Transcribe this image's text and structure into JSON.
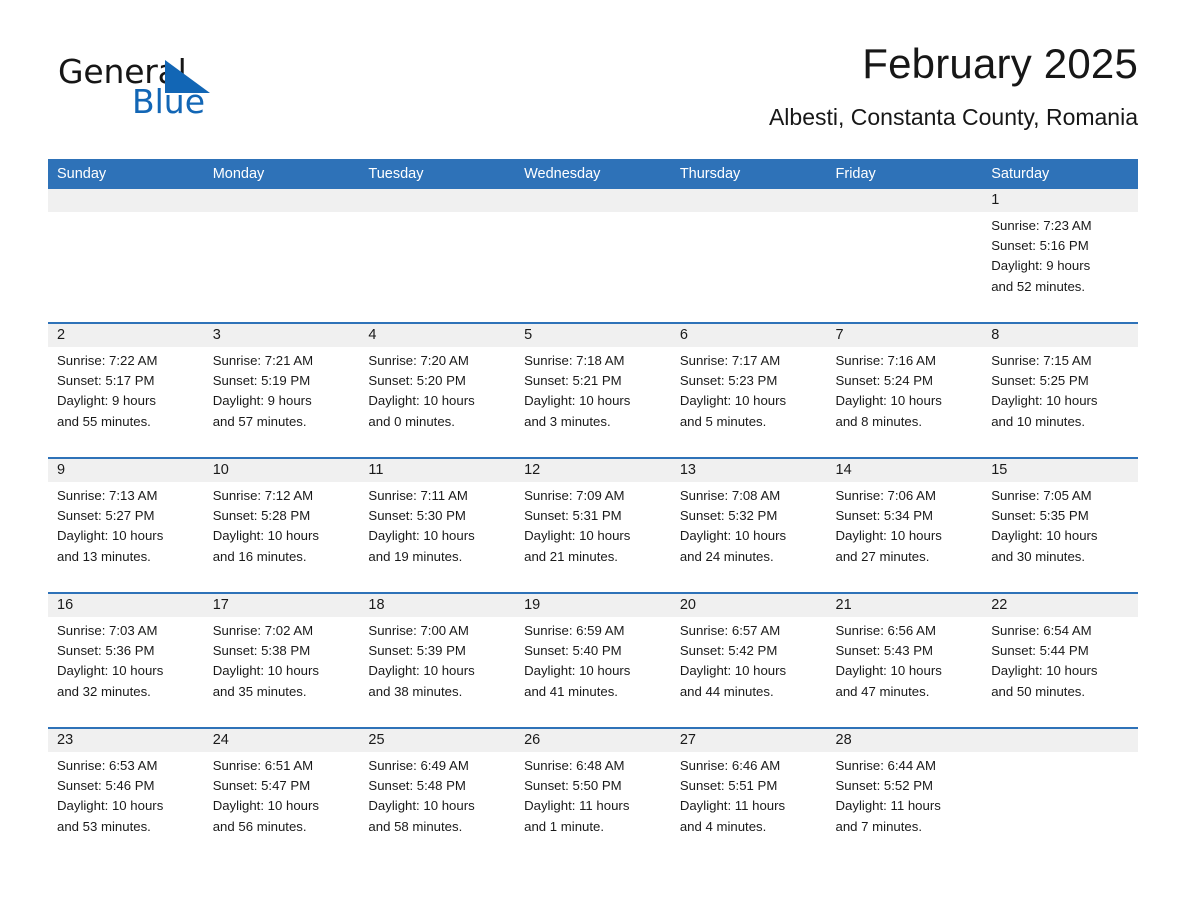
{
  "brand": {
    "name_part1": "General",
    "name_part2": "Blue",
    "logo_icon": "triangle-flag-icon",
    "accent_color": "#1266b5"
  },
  "header": {
    "title": "February 2025",
    "location": "Albesti, Constanta County, Romania"
  },
  "theme": {
    "header_blue": "#2e72b8",
    "day_band_gray": "#f0f0f0",
    "text_color": "#1a1a1a"
  },
  "calendar": {
    "weekday_headers": [
      "Sunday",
      "Monday",
      "Tuesday",
      "Wednesday",
      "Thursday",
      "Friday",
      "Saturday"
    ],
    "weeks": [
      [
        {
          "day": "",
          "info": "",
          "empty": true
        },
        {
          "day": "",
          "info": "",
          "empty": true
        },
        {
          "day": "",
          "info": "",
          "empty": true
        },
        {
          "day": "",
          "info": "",
          "empty": true
        },
        {
          "day": "",
          "info": "",
          "empty": true
        },
        {
          "day": "",
          "info": "",
          "empty": true
        },
        {
          "day": "1",
          "sunrise": "Sunrise: 7:23 AM",
          "sunset": "Sunset: 5:16 PM",
          "daylight": "Daylight: 9 hours and 52 minutes.",
          "info": "Sunrise: 7:23 AM\nSunset: 5:16 PM\nDaylight: 9 hours\nand 52 minutes."
        }
      ],
      [
        {
          "day": "2",
          "sunrise": "Sunrise: 7:22 AM",
          "sunset": "Sunset: 5:17 PM",
          "daylight": "Daylight: 9 hours and 55 minutes.",
          "info": "Sunrise: 7:22 AM\nSunset: 5:17 PM\nDaylight: 9 hours\nand 55 minutes."
        },
        {
          "day": "3",
          "sunrise": "Sunrise: 7:21 AM",
          "sunset": "Sunset: 5:19 PM",
          "daylight": "Daylight: 9 hours and 57 minutes.",
          "info": "Sunrise: 7:21 AM\nSunset: 5:19 PM\nDaylight: 9 hours\nand 57 minutes."
        },
        {
          "day": "4",
          "sunrise": "Sunrise: 7:20 AM",
          "sunset": "Sunset: 5:20 PM",
          "daylight": "Daylight: 10 hours and 0 minutes.",
          "info": "Sunrise: 7:20 AM\nSunset: 5:20 PM\nDaylight: 10 hours\nand 0 minutes."
        },
        {
          "day": "5",
          "sunrise": "Sunrise: 7:18 AM",
          "sunset": "Sunset: 5:21 PM",
          "daylight": "Daylight: 10 hours and 3 minutes.",
          "info": "Sunrise: 7:18 AM\nSunset: 5:21 PM\nDaylight: 10 hours\nand 3 minutes."
        },
        {
          "day": "6",
          "sunrise": "Sunrise: 7:17 AM",
          "sunset": "Sunset: 5:23 PM",
          "daylight": "Daylight: 10 hours and 5 minutes.",
          "info": "Sunrise: 7:17 AM\nSunset: 5:23 PM\nDaylight: 10 hours\nand 5 minutes."
        },
        {
          "day": "7",
          "sunrise": "Sunrise: 7:16 AM",
          "sunset": "Sunset: 5:24 PM",
          "daylight": "Daylight: 10 hours and 8 minutes.",
          "info": "Sunrise: 7:16 AM\nSunset: 5:24 PM\nDaylight: 10 hours\nand 8 minutes."
        },
        {
          "day": "8",
          "sunrise": "Sunrise: 7:15 AM",
          "sunset": "Sunset: 5:25 PM",
          "daylight": "Daylight: 10 hours and 10 minutes.",
          "info": "Sunrise: 7:15 AM\nSunset: 5:25 PM\nDaylight: 10 hours\nand 10 minutes."
        }
      ],
      [
        {
          "day": "9",
          "sunrise": "Sunrise: 7:13 AM",
          "sunset": "Sunset: 5:27 PM",
          "daylight": "Daylight: 10 hours and 13 minutes.",
          "info": "Sunrise: 7:13 AM\nSunset: 5:27 PM\nDaylight: 10 hours\nand 13 minutes."
        },
        {
          "day": "10",
          "sunrise": "Sunrise: 7:12 AM",
          "sunset": "Sunset: 5:28 PM",
          "daylight": "Daylight: 10 hours and 16 minutes.",
          "info": "Sunrise: 7:12 AM\nSunset: 5:28 PM\nDaylight: 10 hours\nand 16 minutes."
        },
        {
          "day": "11",
          "sunrise": "Sunrise: 7:11 AM",
          "sunset": "Sunset: 5:30 PM",
          "daylight": "Daylight: 10 hours and 19 minutes.",
          "info": "Sunrise: 7:11 AM\nSunset: 5:30 PM\nDaylight: 10 hours\nand 19 minutes."
        },
        {
          "day": "12",
          "sunrise": "Sunrise: 7:09 AM",
          "sunset": "Sunset: 5:31 PM",
          "daylight": "Daylight: 10 hours and 21 minutes.",
          "info": "Sunrise: 7:09 AM\nSunset: 5:31 PM\nDaylight: 10 hours\nand 21 minutes."
        },
        {
          "day": "13",
          "sunrise": "Sunrise: 7:08 AM",
          "sunset": "Sunset: 5:32 PM",
          "daylight": "Daylight: 10 hours and 24 minutes.",
          "info": "Sunrise: 7:08 AM\nSunset: 5:32 PM\nDaylight: 10 hours\nand 24 minutes."
        },
        {
          "day": "14",
          "sunrise": "Sunrise: 7:06 AM",
          "sunset": "Sunset: 5:34 PM",
          "daylight": "Daylight: 10 hours and 27 minutes.",
          "info": "Sunrise: 7:06 AM\nSunset: 5:34 PM\nDaylight: 10 hours\nand 27 minutes."
        },
        {
          "day": "15",
          "sunrise": "Sunrise: 7:05 AM",
          "sunset": "Sunset: 5:35 PM",
          "daylight": "Daylight: 10 hours and 30 minutes.",
          "info": "Sunrise: 7:05 AM\nSunset: 5:35 PM\nDaylight: 10 hours\nand 30 minutes."
        }
      ],
      [
        {
          "day": "16",
          "sunrise": "Sunrise: 7:03 AM",
          "sunset": "Sunset: 5:36 PM",
          "daylight": "Daylight: 10 hours and 32 minutes.",
          "info": "Sunrise: 7:03 AM\nSunset: 5:36 PM\nDaylight: 10 hours\nand 32 minutes."
        },
        {
          "day": "17",
          "sunrise": "Sunrise: 7:02 AM",
          "sunset": "Sunset: 5:38 PM",
          "daylight": "Daylight: 10 hours and 35 minutes.",
          "info": "Sunrise: 7:02 AM\nSunset: 5:38 PM\nDaylight: 10 hours\nand 35 minutes."
        },
        {
          "day": "18",
          "sunrise": "Sunrise: 7:00 AM",
          "sunset": "Sunset: 5:39 PM",
          "daylight": "Daylight: 10 hours and 38 minutes.",
          "info": "Sunrise: 7:00 AM\nSunset: 5:39 PM\nDaylight: 10 hours\nand 38 minutes."
        },
        {
          "day": "19",
          "sunrise": "Sunrise: 6:59 AM",
          "sunset": "Sunset: 5:40 PM",
          "daylight": "Daylight: 10 hours and 41 minutes.",
          "info": "Sunrise: 6:59 AM\nSunset: 5:40 PM\nDaylight: 10 hours\nand 41 minutes."
        },
        {
          "day": "20",
          "sunrise": "Sunrise: 6:57 AM",
          "sunset": "Sunset: 5:42 PM",
          "daylight": "Daylight: 10 hours and 44 minutes.",
          "info": "Sunrise: 6:57 AM\nSunset: 5:42 PM\nDaylight: 10 hours\nand 44 minutes."
        },
        {
          "day": "21",
          "sunrise": "Sunrise: 6:56 AM",
          "sunset": "Sunset: 5:43 PM",
          "daylight": "Daylight: 10 hours and 47 minutes.",
          "info": "Sunrise: 6:56 AM\nSunset: 5:43 PM\nDaylight: 10 hours\nand 47 minutes."
        },
        {
          "day": "22",
          "sunrise": "Sunrise: 6:54 AM",
          "sunset": "Sunset: 5:44 PM",
          "daylight": "Daylight: 10 hours and 50 minutes.",
          "info": "Sunrise: 6:54 AM\nSunset: 5:44 PM\nDaylight: 10 hours\nand 50 minutes."
        }
      ],
      [
        {
          "day": "23",
          "sunrise": "Sunrise: 6:53 AM",
          "sunset": "Sunset: 5:46 PM",
          "daylight": "Daylight: 10 hours and 53 minutes.",
          "info": "Sunrise: 6:53 AM\nSunset: 5:46 PM\nDaylight: 10 hours\nand 53 minutes."
        },
        {
          "day": "24",
          "sunrise": "Sunrise: 6:51 AM",
          "sunset": "Sunset: 5:47 PM",
          "daylight": "Daylight: 10 hours and 56 minutes.",
          "info": "Sunrise: 6:51 AM\nSunset: 5:47 PM\nDaylight: 10 hours\nand 56 minutes."
        },
        {
          "day": "25",
          "sunrise": "Sunrise: 6:49 AM",
          "sunset": "Sunset: 5:48 PM",
          "daylight": "Daylight: 10 hours and 58 minutes.",
          "info": "Sunrise: 6:49 AM\nSunset: 5:48 PM\nDaylight: 10 hours\nand 58 minutes."
        },
        {
          "day": "26",
          "sunrise": "Sunrise: 6:48 AM",
          "sunset": "Sunset: 5:50 PM",
          "daylight": "Daylight: 11 hours and 1 minute.",
          "info": "Sunrise: 6:48 AM\nSunset: 5:50 PM\nDaylight: 11 hours\nand 1 minute."
        },
        {
          "day": "27",
          "sunrise": "Sunrise: 6:46 AM",
          "sunset": "Sunset: 5:51 PM",
          "daylight": "Daylight: 11 hours and 4 minutes.",
          "info": "Sunrise: 6:46 AM\nSunset: 5:51 PM\nDaylight: 11 hours\nand 4 minutes."
        },
        {
          "day": "28",
          "sunrise": "Sunrise: 6:44 AM",
          "sunset": "Sunset: 5:52 PM",
          "daylight": "Daylight: 11 hours and 7 minutes.",
          "info": "Sunrise: 6:44 AM\nSunset: 5:52 PM\nDaylight: 11 hours\nand 7 minutes."
        },
        {
          "day": "",
          "info": "",
          "empty": true
        }
      ]
    ]
  }
}
